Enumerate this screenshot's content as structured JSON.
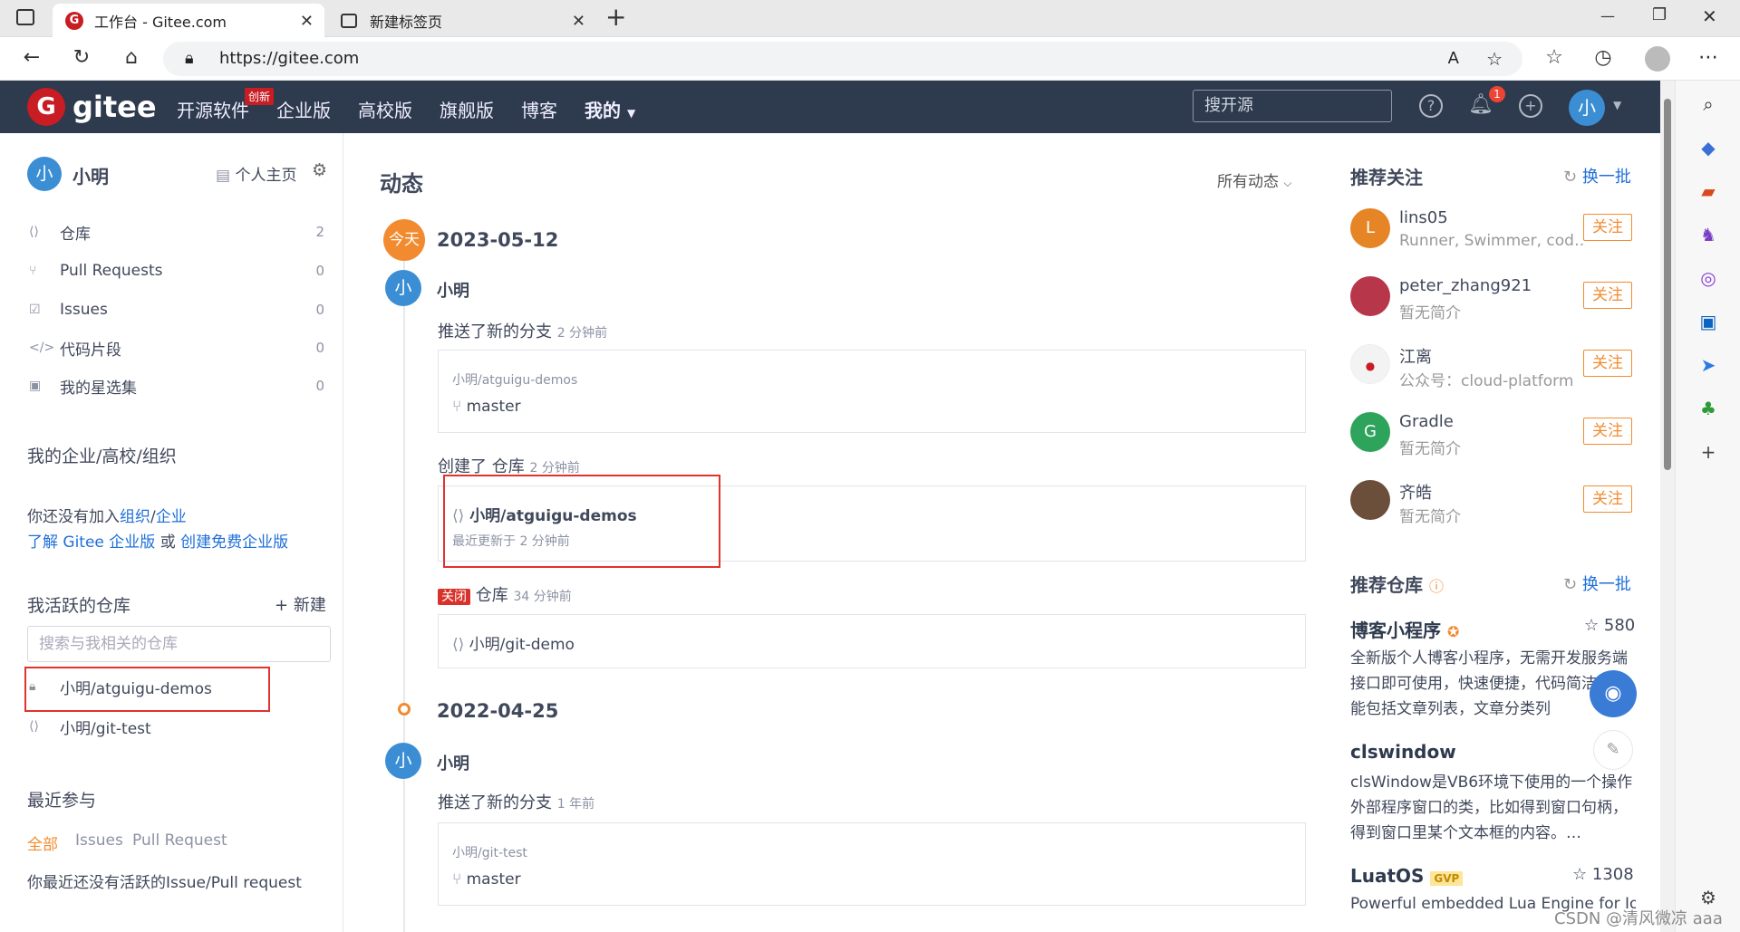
{
  "browser": {
    "tabs": [
      {
        "title": "工作台 - Gitee.com"
      },
      {
        "title": "新建标签页"
      }
    ],
    "url": "https://gitee.com",
    "close_glyph": "✕",
    "new_tab_glyph": "+",
    "min_glyph": "—",
    "max_glyph": "❐"
  },
  "nav": {
    "brand": "gitee",
    "badge": "创新",
    "links": [
      "开源软件",
      "企业版",
      "高校版",
      "旗舰版",
      "博客",
      "我的"
    ],
    "search_placeholder": "搜开源",
    "notification_count": "1",
    "avatar": "小"
  },
  "left": {
    "user_name": "小明",
    "avatar": "小",
    "homepage": "个人主页",
    "menu": [
      {
        "label": "仓库",
        "count": "2"
      },
      {
        "label": "Pull Requests",
        "count": "0"
      },
      {
        "label": "Issues",
        "count": "0"
      },
      {
        "label": "代码片段",
        "count": "0"
      },
      {
        "label": "我的星选集",
        "count": "0"
      }
    ],
    "org_title": "我的企业/高校/组织",
    "org_text1": "你还没有加入",
    "org_link1": "组织",
    "org_sep": "/",
    "org_link2": "企业",
    "org_link3": "了解 Gitee 企业版",
    "org_or": " 或 ",
    "org_link4": "创建免费企业版",
    "active_title": "我活跃的仓库",
    "new_btn": "新建",
    "repo_search_placeholder": "搜索与我相关的仓库",
    "repos": [
      "小明/atguigu-demos",
      "小明/git-test"
    ],
    "recent_title": "最近参与",
    "recent_tabs": [
      "全部",
      "Issues",
      "Pull Request"
    ],
    "recent_empty": "你最近还没有活跃的Issue/Pull request"
  },
  "feed": {
    "title": "动态",
    "filter": "所有动态",
    "today": "今天",
    "dates": [
      "2023-05-12",
      "2022-04-25"
    ],
    "user": "小明",
    "avatar": "小",
    "e1_action": "推送了新的分支",
    "e1_time": "2 分钟前",
    "e1_repo": "小明/atguigu-demos",
    "e1_branch": "master",
    "e2_action": "创建了 仓库",
    "e2_time": "2 分钟前",
    "e2_repo": "小明/atguigu-demos",
    "e2_updated": "最近更新于 2 分钟前",
    "e3_tag": "关闭",
    "e3_action": "仓库",
    "e3_time": "34 分钟前",
    "e3_repo": "小明/git-demo",
    "e4_action": "推送了新的分支",
    "e4_time": "1 年前",
    "e4_repo": "小明/git-test",
    "e4_branch": "master"
  },
  "right": {
    "rec_follow_title": "推荐关注",
    "refresh": "换一批",
    "follow_label": "关注",
    "users": [
      {
        "name": "lins05",
        "desc": "Runner, Swimmer, cod…",
        "avatar": "L",
        "color": "#e58525"
      },
      {
        "name": "peter_zhang921",
        "desc": "暂无简介",
        "avatar": "",
        "color": "#c0392b"
      },
      {
        "name": "江离",
        "desc": "公众号：cloud-platform",
        "avatar": "",
        "color": "#f5f5f5"
      },
      {
        "name": "Gradle",
        "desc": "暂无简介",
        "avatar": "G",
        "color": "#2ea35c"
      },
      {
        "name": "齐皓",
        "desc": "暂无简介",
        "avatar": "",
        "color": "#6b4f3a"
      }
    ],
    "rec_repo_title": "推荐仓库",
    "repos": [
      {
        "name": "博客小程序",
        "stars": "580",
        "desc": "全新版个人博客小程序，无需开发服务端接口即可使用，快速便捷，代码简洁，功能包括文章列表，文章分类列"
      },
      {
        "name": "clswindow",
        "stars": "",
        "desc": "clsWindow是VB6环境下使用的一个操作外部程序窗口的类，比如得到窗口句柄，得到窗口里某个文本框的内容。…"
      },
      {
        "name": "LuatOS",
        "stars": "1308",
        "badge": "GVP",
        "desc": "Powerful embedded Lua Engine for IoT"
      }
    ]
  },
  "watermark": "CSDN @清风微凉 aaa"
}
